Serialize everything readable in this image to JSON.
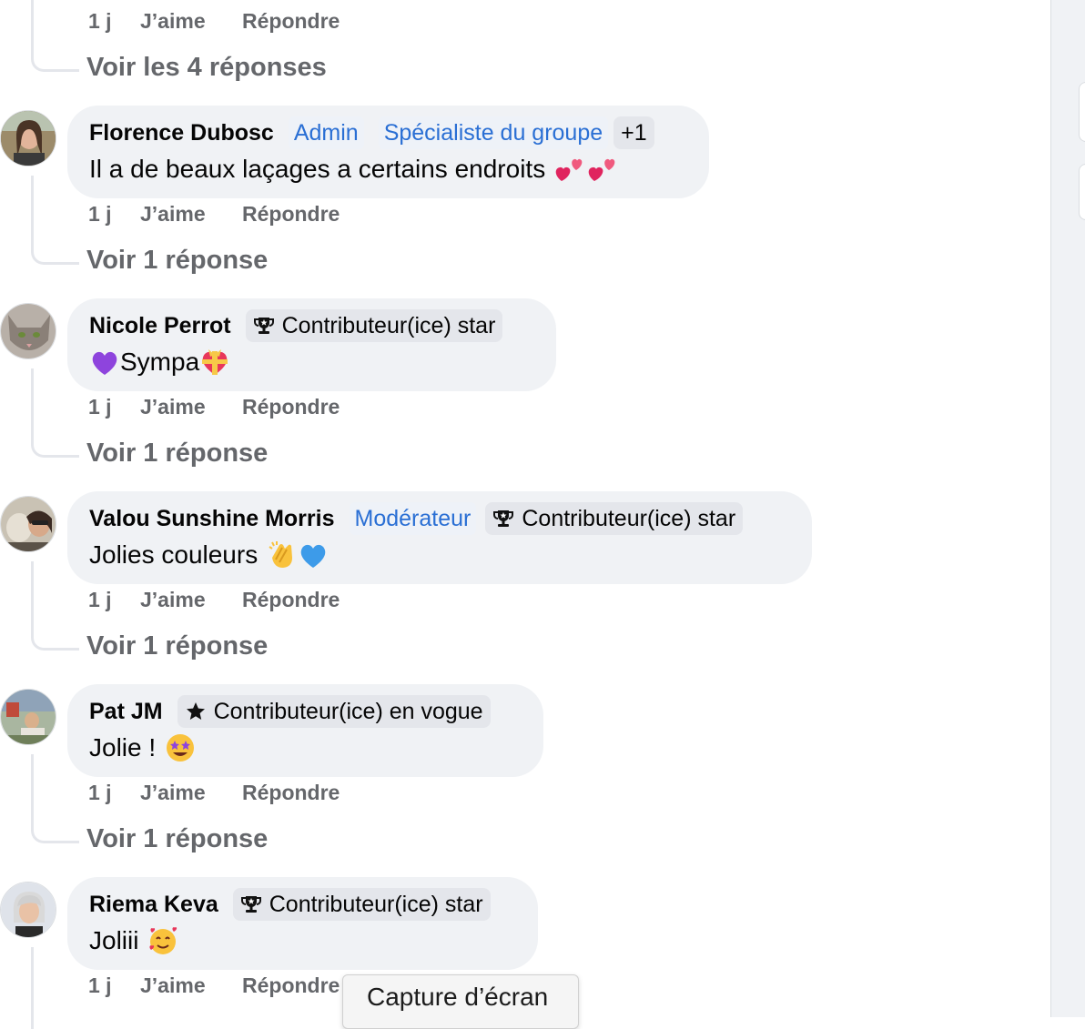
{
  "top_comment": {
    "actions": {
      "time": "1 j",
      "like": "J’aime",
      "reply": "Répondre"
    },
    "replies_link": "Voir les 4 réponses"
  },
  "comments": [
    {
      "author": "Florence Dubosc",
      "badges": [
        "Admin",
        "Spécialiste du groupe",
        "+1"
      ],
      "text": "Il a de beaux laçages a certains endroits",
      "emojis": [
        "two-hearts",
        "two-hearts"
      ],
      "actions": {
        "time": "1 j",
        "like": "J’aime",
        "reply": "Répondre"
      },
      "replies_link": "Voir 1 réponse"
    },
    {
      "author": "Nicole Perrot",
      "badges": [
        "Contributeur(ice) star"
      ],
      "text": "Sympa",
      "emojis": [
        "purple-heart",
        "heart-with-ribbon"
      ],
      "actions": {
        "time": "1 j",
        "like": "J’aime",
        "reply": "Répondre"
      },
      "replies_link": "Voir 1 réponse"
    },
    {
      "author": "Valou Sunshine Morris",
      "badges": [
        "Modérateur",
        "Contributeur(ice) star"
      ],
      "text": "Jolies couleurs",
      "emojis": [
        "clapping-hands",
        "blue-heart"
      ],
      "actions": {
        "time": "1 j",
        "like": "J’aime",
        "reply": "Répondre"
      },
      "replies_link": "Voir 1 réponse"
    },
    {
      "author": "Pat JM",
      "badges": [
        "Contributeur(ice) en vogue"
      ],
      "text": "Jolie !",
      "emojis": [
        "star-struck-face"
      ],
      "actions": {
        "time": "1 j",
        "like": "J’aime",
        "reply": "Répondre"
      },
      "replies_link": "Voir 1 réponse"
    },
    {
      "author": "Riema Keva",
      "badges": [
        "Contributeur(ice) star"
      ],
      "text": "Joliii",
      "emojis": [
        "smiling-face-with-hearts"
      ],
      "actions": {
        "time": "1 j",
        "like": "J’aime",
        "reply": "Répondre"
      }
    }
  ],
  "tooltip": {
    "label": "Capture d’écran"
  },
  "colors": {
    "bubble_bg": "#f0f2f5",
    "secondary_text": "#65676b",
    "role_badge_text": "#2a6fd4",
    "badge_bg": "#e4e6eb"
  }
}
